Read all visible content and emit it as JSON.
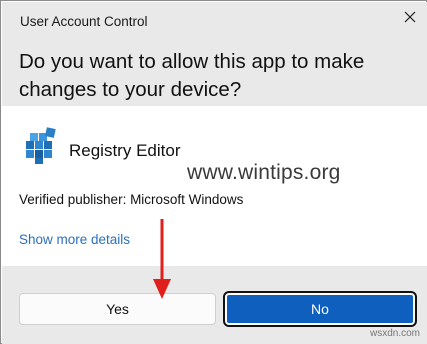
{
  "window": {
    "title": "User Account Control",
    "close_icon": "close-icon"
  },
  "prompt": {
    "question": "Do you want to allow this app to make changes to your device?"
  },
  "app": {
    "name": "Registry Editor",
    "icon": "registry-editor-icon",
    "publisher": "Verified publisher: Microsoft Windows"
  },
  "links": {
    "show_more": "Show more details"
  },
  "buttons": {
    "yes": "Yes",
    "no": "No"
  },
  "watermark": "www.wintips.org",
  "site_mark": "wsxdn.com",
  "annotation": {
    "arrow_color": "#e0201c",
    "points_to": "yes-button"
  },
  "colors": {
    "header_bg": "#e9e9e9",
    "link": "#2b6fbd",
    "primary_button": "#0f5fbf"
  }
}
